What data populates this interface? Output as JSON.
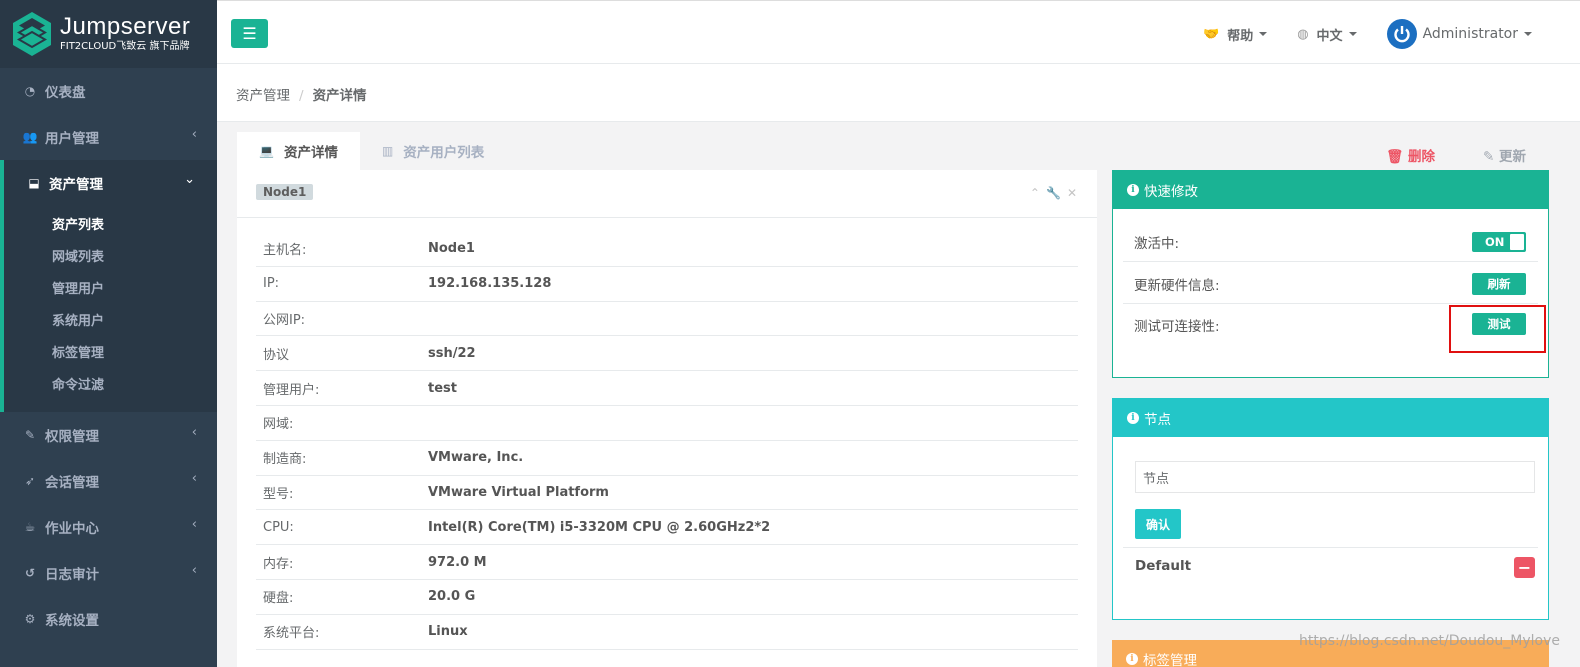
{
  "brand": {
    "name": "Jumpserver",
    "tagline": "FIT2CLOUD飞致云 旗下品牌"
  },
  "sidebar": {
    "items": [
      {
        "label": "仪表盘",
        "icon": "dashboard-icon"
      },
      {
        "label": "用户管理",
        "icon": "users-icon"
      },
      {
        "label": "资产管理",
        "icon": "inbox-icon",
        "active": true
      },
      {
        "label": "权限管理",
        "icon": "edit-icon"
      },
      {
        "label": "会话管理",
        "icon": "rocket-icon"
      },
      {
        "label": "作业中心",
        "icon": "coffee-icon"
      },
      {
        "label": "日志审计",
        "icon": "history-icon"
      },
      {
        "label": "系统设置",
        "icon": "gears-icon"
      }
    ],
    "asset_sub": [
      "资产列表",
      "网域列表",
      "管理用户",
      "系统用户",
      "标签管理",
      "命令过滤"
    ]
  },
  "topbar": {
    "help": "帮助",
    "language": "中文",
    "user": "Administrator"
  },
  "breadcrumb": {
    "parent": "资产管理",
    "separator": "/",
    "current": "资产详情"
  },
  "tabs": {
    "detail": "资产详情",
    "users": "资产用户列表"
  },
  "actions": {
    "delete": "删除",
    "update": "更新"
  },
  "detail": {
    "node_label": "Node1",
    "rows": [
      {
        "key": "主机名:",
        "value": "Node1"
      },
      {
        "key": "IP:",
        "value": "192.168.135.128"
      },
      {
        "key": "公网IP:",
        "value": ""
      },
      {
        "key": "协议",
        "value": "ssh/22"
      },
      {
        "key": "管理用户:",
        "value": "test"
      },
      {
        "key": "网域:",
        "value": ""
      },
      {
        "key": "制造商:",
        "value": "VMware, Inc."
      },
      {
        "key": "型号:",
        "value": "VMware Virtual Platform"
      },
      {
        "key": "CPU:",
        "value": "Intel(R) Core(TM) i5-3320M CPU @ 2.60GHz2*2"
      },
      {
        "key": "内存:",
        "value": "972.0 M"
      },
      {
        "key": "硬盘:",
        "value": "20.0 G"
      },
      {
        "key": "系统平台:",
        "value": "Linux"
      }
    ]
  },
  "quick": {
    "title": "快速修改",
    "active_label": "激活中:",
    "active_toggle": "ON",
    "hardware_label": "更新硬件信息:",
    "refresh_btn": "刷新",
    "test_label": "测试可连接性:",
    "test_btn": "测试"
  },
  "nodes": {
    "title": "节点",
    "input_placeholder": "节点",
    "confirm_btn": "确认",
    "items": [
      "Default"
    ]
  },
  "labels_panel": {
    "title": "标签管理"
  },
  "watermark": "https://blog.csdn.net/Doudou_Mylove"
}
